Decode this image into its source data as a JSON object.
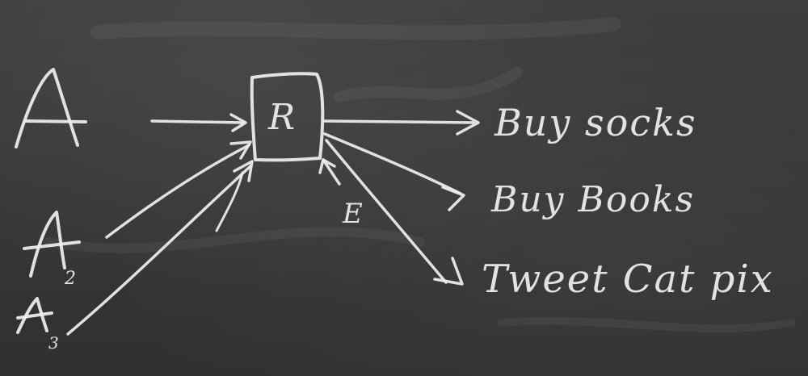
{
  "board": {
    "router_label": "R",
    "agents": [
      {
        "letter": "A",
        "subscript": ""
      },
      {
        "letter": "A",
        "subscript": "2"
      },
      {
        "letter": "A",
        "subscript": "3"
      }
    ],
    "edge_label": "E",
    "actions": [
      "Buy socks",
      "Buy Books",
      "Tweet Cat pix"
    ]
  },
  "colors": {
    "board": "#3a3b3d",
    "chalk": "#eeeeec"
  }
}
